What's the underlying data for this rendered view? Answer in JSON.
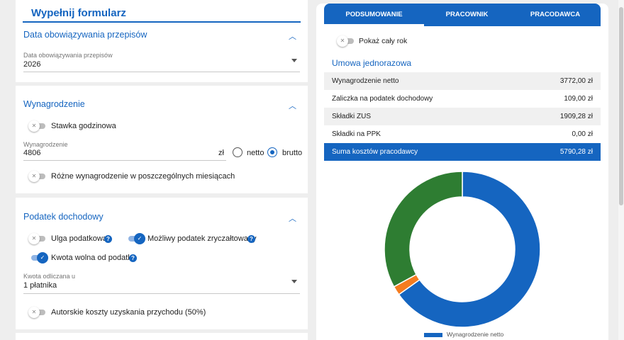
{
  "form": {
    "title": "Wypełnij formularz",
    "section_dates": {
      "header": "Data obowiązywania przepisów",
      "field_label": "Data obowiązywania przepisów",
      "field_value": "2026"
    },
    "section_salary": {
      "header": "Wynagrodzenie",
      "hourly_toggle_label": "Stawka godzinowa",
      "salary_label": "Wynagrodzenie",
      "salary_value": "4806",
      "currency": "zł",
      "net_label": "netto",
      "gross_label": "brutto",
      "different_monthly_label": "Różne wynagrodzenie w poszczególnych miesiącach"
    },
    "section_tax": {
      "header": "Podatek dochodowy",
      "tax_relief_label": "Ulga podatkowa",
      "flat_tax_label": "Możliwy podatek zryczałtowany",
      "free_amount_label": "Kwota wolna od podatku",
      "deducted_at_label": "Kwota odliczana u",
      "deducted_at_value": "1 płatnika",
      "author_costs_label": "Autorskie koszty uzyskania przychodu (50%)"
    }
  },
  "summary": {
    "tabs": [
      "PODSUMOWANIE",
      "PRACOWNIK",
      "PRACODAWCA"
    ],
    "show_year_label": "Pokaż cały rok",
    "contract_title": "Umowa jednorazowa",
    "rows": [
      {
        "label": "Wynagrodzenie netto",
        "value": "3772,00 zł"
      },
      {
        "label": "Zaliczka na podatek dochodowy",
        "value": "109,00 zł"
      },
      {
        "label": "Składki ZUS",
        "value": "1909,28 zł"
      },
      {
        "label": "Składki na PPK",
        "value": "0,00 zł"
      },
      {
        "label": "Suma kosztów pracodawcy",
        "value": "5790,28 zł"
      }
    ],
    "legend_label": "Wynagrodzenie netto"
  },
  "chart_data": {
    "type": "pie",
    "donut": true,
    "categories": [
      "Wynagrodzenie netto",
      "Zaliczka na podatek dochodowy",
      "Składki ZUS",
      "Składki na PPK"
    ],
    "values": [
      3772.0,
      109.0,
      1909.28,
      0.0
    ],
    "colors": [
      "#1565c0",
      "#f57c1f",
      "#2e7d32",
      "#9e9e9e"
    ]
  },
  "colors": {
    "accent": "#1565c0",
    "orange": "#f57c1f",
    "green": "#2e7d32"
  }
}
